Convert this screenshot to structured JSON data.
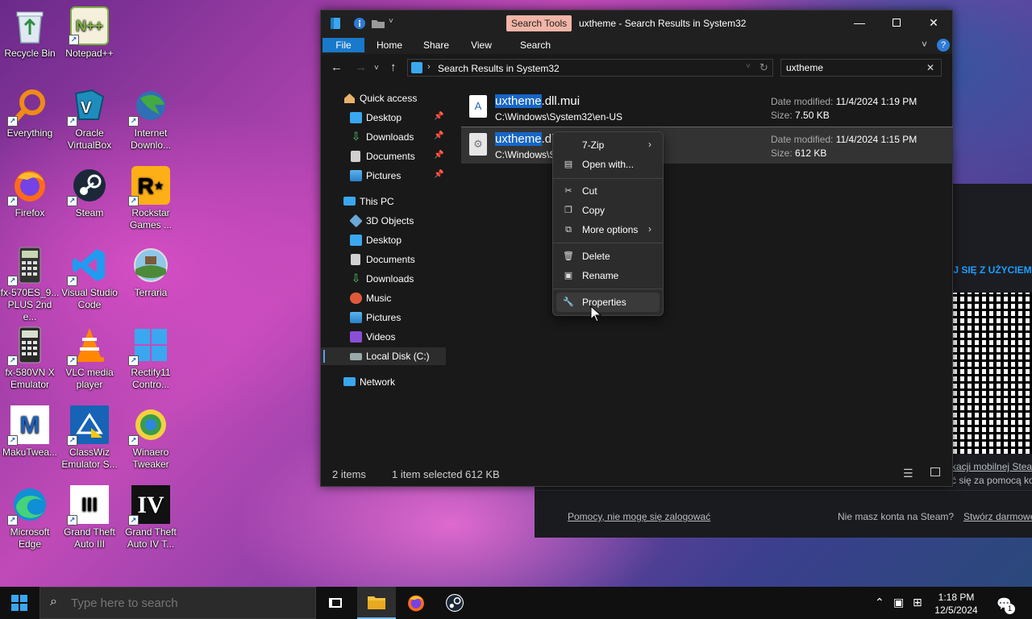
{
  "desktop": {
    "icons": [
      {
        "label": "Recycle Bin"
      },
      {
        "label": "Notepad++"
      },
      {
        "label": "Everything"
      },
      {
        "label": "Oracle VirtualBox"
      },
      {
        "label": "Internet Downlo..."
      },
      {
        "label": "Firefox"
      },
      {
        "label": "Steam"
      },
      {
        "label": "Rockstar Games ..."
      },
      {
        "label": "fx-570ES_9... PLUS 2nd e..."
      },
      {
        "label": "Visual Studio Code"
      },
      {
        "label": "Terraria"
      },
      {
        "label": "fx-580VN X Emulator"
      },
      {
        "label": "VLC media player"
      },
      {
        "label": "Rectify11 Contro..."
      },
      {
        "label": "MakuTwea..."
      },
      {
        "label": "ClassWiz Emulator S..."
      },
      {
        "label": "Winaero Tweaker"
      },
      {
        "label": "Microsoft Edge"
      },
      {
        "label": "Grand Theft Auto III"
      },
      {
        "label": "Grand Theft Auto IV T..."
      }
    ]
  },
  "steam": {
    "login_title": "OGUJ SIĘ Z UŻYCIEM",
    "app_line1": "kacji mobilnej Steam",
    "app_line2": "ć się za pomocą kodu",
    "help_link": "Pomocy, nie mogę się zalogować",
    "no_account": "Nie masz konta na Steam?",
    "create_link": "Stwórz darmowe konto"
  },
  "explorer": {
    "search_tools_label": "Search Tools",
    "title": "uxtheme - Search Results in System32",
    "ribbon_tabs": [
      "File",
      "Home",
      "Share",
      "View",
      "Search"
    ],
    "address": "Search Results in System32",
    "search_value": "uxtheme",
    "nav": {
      "quick_access": "Quick access",
      "quick_items": [
        "Desktop",
        "Downloads",
        "Documents",
        "Pictures"
      ],
      "this_pc": "This PC",
      "pc_items": [
        "3D Objects",
        "Desktop",
        "Documents",
        "Downloads",
        "Music",
        "Pictures",
        "Videos",
        "Local Disk (C:)"
      ],
      "network": "Network"
    },
    "files": [
      {
        "name_hl": "uxtheme",
        "name_rest": ".dll.mui",
        "path": "C:\\Windows\\System32\\en-US",
        "date_label": "Date modified:",
        "date": "11/4/2024 1:19 PM",
        "size_label": "Size:",
        "size": "7.50 KB"
      },
      {
        "name_hl": "uxtheme",
        "name_rest": ".dll",
        "path": "C:\\Windows\\System32",
        "date_label": "Date modified:",
        "date": "11/4/2024 1:15 PM",
        "size_label": "Size:",
        "size": "612 KB"
      }
    ],
    "status": {
      "items": "2 items",
      "selected": "1 item selected  612 KB"
    }
  },
  "context_menu": {
    "items": [
      "7-Zip",
      "Open with...",
      "Cut",
      "Copy",
      "More options",
      "Delete",
      "Rename",
      "Properties"
    ]
  },
  "taskbar": {
    "search_placeholder": "Type here to search",
    "time": "1:18 PM",
    "date": "12/5/2024",
    "notification_count": "1"
  },
  "colors": {
    "accent": "#1979ca",
    "highlight": "#1766c5",
    "search_tools": "#f2b5a7",
    "steam_blue": "#1a9fff"
  }
}
